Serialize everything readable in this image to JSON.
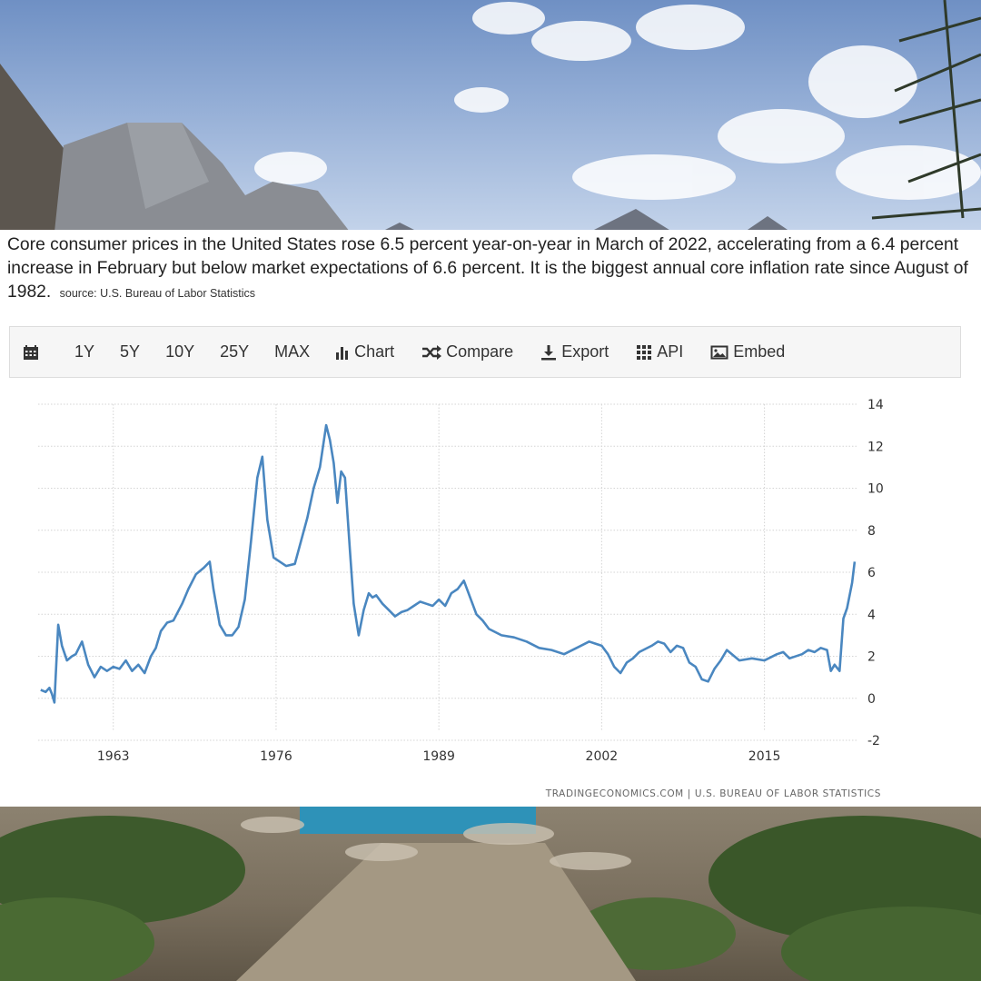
{
  "description": {
    "text": "Core consumer prices in the United States rose 6.5 percent year-on-year in March of 2022, accelerating from a 6.4 percent increase in February but below market expectations of 6.6 percent. It is the biggest annual core inflation rate since August of 1982.",
    "source": "source: U.S. Bureau of Labor Statistics"
  },
  "toolbar": {
    "calendar_icon": "calendar-icon",
    "ranges": [
      "1Y",
      "5Y",
      "10Y",
      "25Y",
      "MAX"
    ],
    "chart_label": "Chart",
    "chart_icon": "bar-chart-icon",
    "compare_label": "Compare",
    "compare_icon": "shuffle-icon",
    "export_label": "Export",
    "export_icon": "download-icon",
    "api_label": "API",
    "api_icon": "grid-icon",
    "embed_label": "Embed",
    "embed_icon": "image-icon"
  },
  "chart_data": {
    "type": "line",
    "title": "",
    "xlabel": "",
    "ylabel": "",
    "line_color": "#4a87c0",
    "x_ticks": [
      "1963",
      "1976",
      "1989",
      "2002",
      "2015"
    ],
    "y_ticks": [
      "14",
      "12",
      "10",
      "8",
      "6",
      "4",
      "2",
      "0",
      "-2"
    ],
    "xlim": [
      1957.0,
      2022.5
    ],
    "ylim": [
      -2,
      14
    ],
    "grid": true,
    "y_axis_side": "right",
    "credit": "TRADINGECONOMICS.COM  |  U.S. BUREAU OF LABOR STATISTICS",
    "x": [
      1957.2,
      1957.6,
      1957.9,
      1958.1,
      1958.3,
      1958.6,
      1958.9,
      1959.3,
      1959.7,
      1960.0,
      1960.5,
      1961.0,
      1961.5,
      1962.0,
      1962.5,
      1963.0,
      1963.5,
      1964.0,
      1964.5,
      1965.0,
      1965.5,
      1966.0,
      1966.4,
      1966.8,
      1967.3,
      1967.8,
      1968.5,
      1969.0,
      1969.6,
      1970.2,
      1970.7,
      1971.0,
      1971.5,
      1972.0,
      1972.5,
      1973.0,
      1973.5,
      1974.0,
      1974.5,
      1974.9,
      1975.3,
      1975.8,
      1976.3,
      1976.8,
      1977.5,
      1978.0,
      1978.5,
      1979.0,
      1979.5,
      1980.0,
      1980.3,
      1980.6,
      1980.9,
      1981.2,
      1981.5,
      1981.9,
      1982.2,
      1982.6,
      1983.0,
      1983.4,
      1983.7,
      1984.0,
      1984.5,
      1985.0,
      1985.5,
      1986.0,
      1986.5,
      1987.0,
      1987.5,
      1988.0,
      1988.5,
      1989.0,
      1989.5,
      1990.0,
      1990.5,
      1991.0,
      1991.5,
      1992.0,
      1992.5,
      1993.0,
      1994.0,
      1995.0,
      1996.0,
      1997.0,
      1998.0,
      1999.0,
      2000.0,
      2001.0,
      2001.5,
      2002.0,
      2002.5,
      2003.0,
      2003.5,
      2004.0,
      2004.5,
      2005.0,
      2006.0,
      2006.5,
      2007.0,
      2007.5,
      2008.0,
      2008.5,
      2009.0,
      2009.5,
      2010.0,
      2010.5,
      2011.0,
      2011.5,
      2012.0,
      2013.0,
      2014.0,
      2015.0,
      2016.0,
      2016.5,
      2017.0,
      2018.0,
      2018.5,
      2019.0,
      2019.5,
      2020.0,
      2020.3,
      2020.6,
      2021.0,
      2021.3,
      2021.6,
      2022.0,
      2022.2
    ],
    "y": [
      0.4,
      0.3,
      0.5,
      0.2,
      -0.2,
      3.5,
      2.5,
      1.8,
      2.0,
      2.1,
      2.7,
      1.6,
      1.0,
      1.5,
      1.3,
      1.5,
      1.4,
      1.8,
      1.3,
      1.6,
      1.2,
      2.0,
      2.4,
      3.2,
      3.6,
      3.7,
      4.5,
      5.2,
      5.9,
      6.2,
      6.5,
      5.2,
      3.5,
      3.0,
      3.0,
      3.4,
      4.7,
      7.5,
      10.5,
      11.5,
      8.5,
      6.7,
      6.5,
      6.3,
      6.4,
      7.5,
      8.6,
      10.0,
      11.0,
      13.0,
      12.3,
      11.2,
      9.3,
      10.8,
      10.5,
      7.0,
      4.5,
      3.0,
      4.2,
      5.0,
      4.8,
      4.9,
      4.5,
      4.2,
      3.9,
      4.1,
      4.2,
      4.4,
      4.6,
      4.5,
      4.4,
      4.7,
      4.4,
      5.0,
      5.2,
      5.6,
      4.8,
      4.0,
      3.7,
      3.3,
      3.0,
      2.9,
      2.7,
      2.4,
      2.3,
      2.1,
      2.4,
      2.7,
      2.6,
      2.5,
      2.1,
      1.5,
      1.2,
      1.7,
      1.9,
      2.2,
      2.5,
      2.7,
      2.6,
      2.2,
      2.5,
      2.4,
      1.7,
      1.5,
      0.9,
      0.8,
      1.4,
      1.8,
      2.3,
      1.8,
      1.9,
      1.8,
      2.1,
      2.2,
      1.9,
      2.1,
      2.3,
      2.2,
      2.4,
      2.3,
      1.3,
      1.6,
      1.3,
      3.8,
      4.3,
      5.5,
      6.5
    ]
  }
}
